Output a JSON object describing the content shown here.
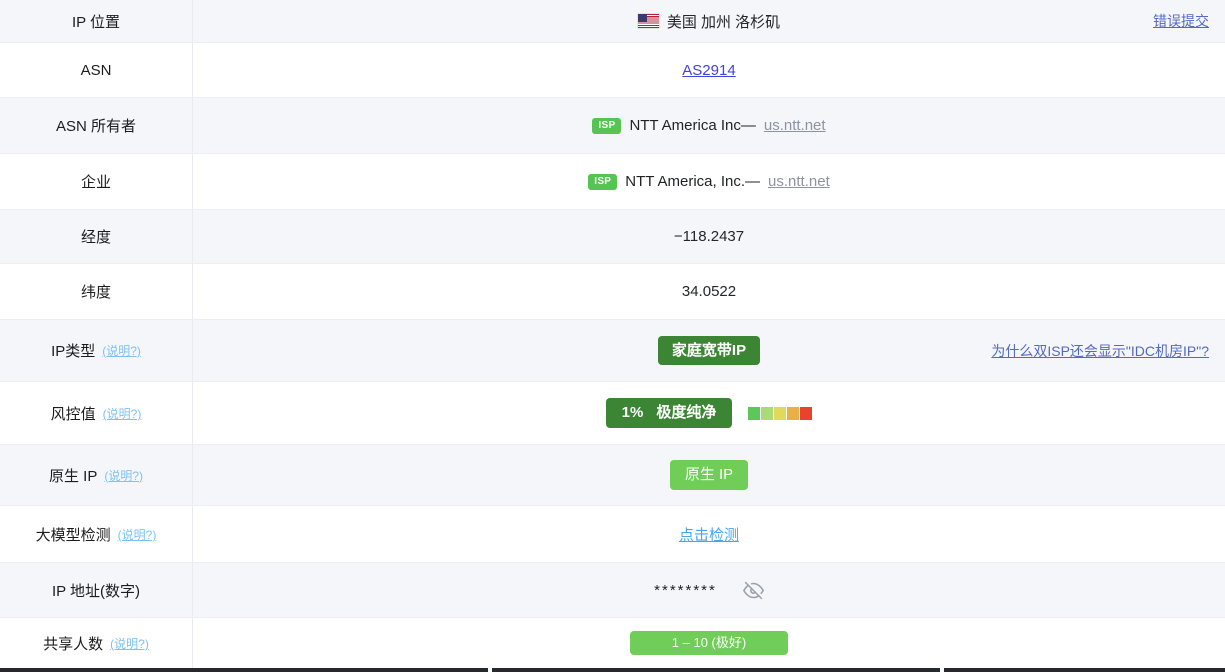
{
  "rows": {
    "ip_location": {
      "label": "IP 位置",
      "value": "美国 加州 洛杉矶",
      "error_link": "错误提交"
    },
    "asn": {
      "label": "ASN",
      "value": "AS2914"
    },
    "asn_owner": {
      "label": "ASN 所有者",
      "isp_badge": "ISP",
      "name": "NTT America Inc—",
      "domain": "us.ntt.net"
    },
    "enterprise": {
      "label": "企业",
      "isp_badge": "ISP",
      "name": "NTT America, Inc.—",
      "domain": "us.ntt.net"
    },
    "longitude": {
      "label": "经度",
      "value": "−118.2437"
    },
    "latitude": {
      "label": "纬度",
      "value": "34.0522"
    },
    "ip_type": {
      "label": "IP类型",
      "hint": "(说明?)",
      "badge": "家庭宽带IP",
      "question_link": "为什么双ISP还会显示\"IDC机房IP\"?"
    },
    "risk": {
      "label": "风控值",
      "hint": "(说明?)",
      "percent": "1%",
      "level": "极度纯净",
      "scale_colors": [
        "#5dc75a",
        "#aadb76",
        "#e0d95c",
        "#eaaf45",
        "#e8432e"
      ]
    },
    "native_ip": {
      "label": "原生 IP",
      "hint": "(说明?)",
      "badge": "原生 IP"
    },
    "llm_detect": {
      "label": "大模型检测",
      "hint": "(说明?)",
      "action_link": "点击检测"
    },
    "ip_number": {
      "label": "IP 地址(数字)",
      "masked_value": "********"
    },
    "shared": {
      "label": "共享人数",
      "hint": "(说明?)",
      "badge": "1 – 10 (极好)"
    }
  },
  "colors": {
    "badge_dark_green": "#3c8534",
    "badge_light_green": "#6fcd58",
    "isp_green": "#55c452",
    "link_blue": "#5468c7",
    "asn_link": "#4342d8",
    "hint_blue": "#7cc3f2"
  }
}
